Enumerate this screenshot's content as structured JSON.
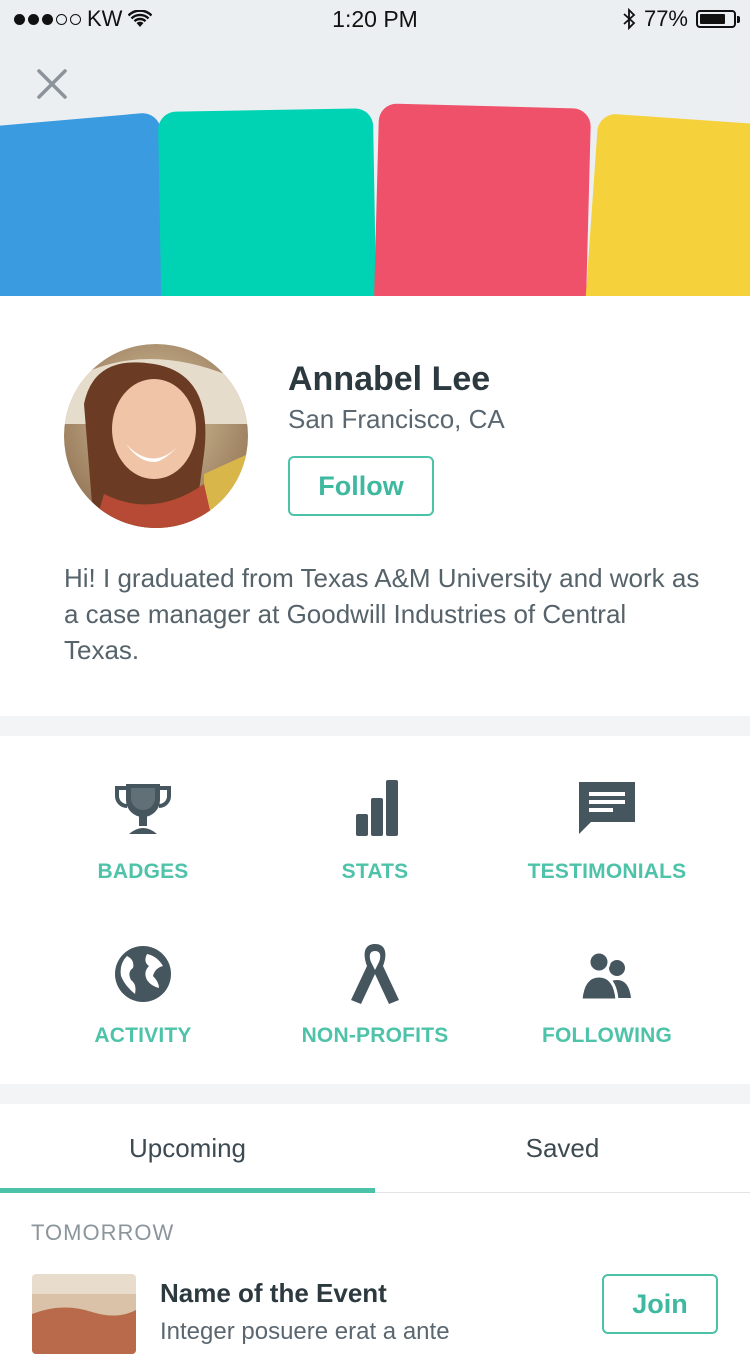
{
  "status_bar": {
    "carrier": "KW",
    "time": "1:20 PM",
    "battery_percent": "77%",
    "battery_level": 0.77,
    "signal_bars_filled": 3,
    "signal_bars_total": 5
  },
  "header": {
    "close_icon": "close-icon",
    "card_colors": [
      "#3a9be0",
      "#00d3b3",
      "#f0516a",
      "#f5d13b"
    ]
  },
  "profile": {
    "name": "Annabel Lee",
    "location": "San Francisco, CA",
    "follow_label": "Follow",
    "bio": "Hi! I graduated from Texas A&M University and work as a case manager at Goodwill Industries of Central Texas."
  },
  "grid": {
    "items": [
      {
        "label": "BADGES",
        "icon": "trophy-icon"
      },
      {
        "label": "STATS",
        "icon": "bar-chart-icon"
      },
      {
        "label": "TESTIMONIALS",
        "icon": "message-icon"
      },
      {
        "label": "ACTIVITY",
        "icon": "globe-icon"
      },
      {
        "label": "NON-PROFITS",
        "icon": "ribbon-icon"
      },
      {
        "label": "FOLLOWING",
        "icon": "people-icon"
      }
    ]
  },
  "tabs": {
    "items": [
      "Upcoming",
      "Saved"
    ],
    "active": "Upcoming"
  },
  "events": {
    "section_label": "TOMORROW",
    "items": [
      {
        "title": "Name of the Event",
        "description": "Integer posuere erat a ante",
        "join_label": "Join"
      }
    ]
  },
  "colors": {
    "accent": "#4cc3a9",
    "text_dark": "#2c3a40",
    "icon": "#46565f"
  }
}
